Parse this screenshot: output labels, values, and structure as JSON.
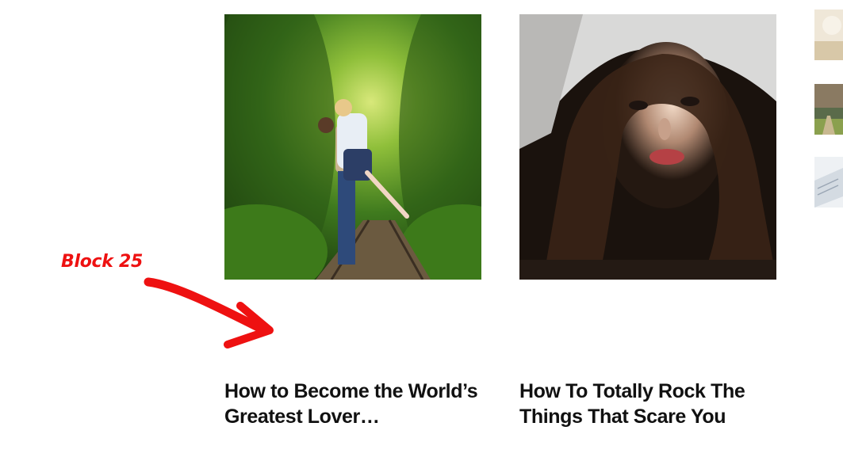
{
  "annotation": {
    "label": "Block 25",
    "color": "#ee1111"
  },
  "posts": [
    {
      "title": "How to Become the World’s Greatest Lover…",
      "image": "couple-on-railway-tracks-in-green-tunnel"
    },
    {
      "title": "How To Totally Rock The Things That Scare You",
      "image": "frightened-woman-in-dark-under-sheet"
    }
  ],
  "sidebar_thumbnails": [
    {
      "image": "beige-light-thumbnail"
    },
    {
      "image": "park-path-thumbnail"
    },
    {
      "image": "paper-note-thumbnail"
    }
  ],
  "colors": {
    "title_text": "#111111",
    "background": "#ffffff"
  }
}
